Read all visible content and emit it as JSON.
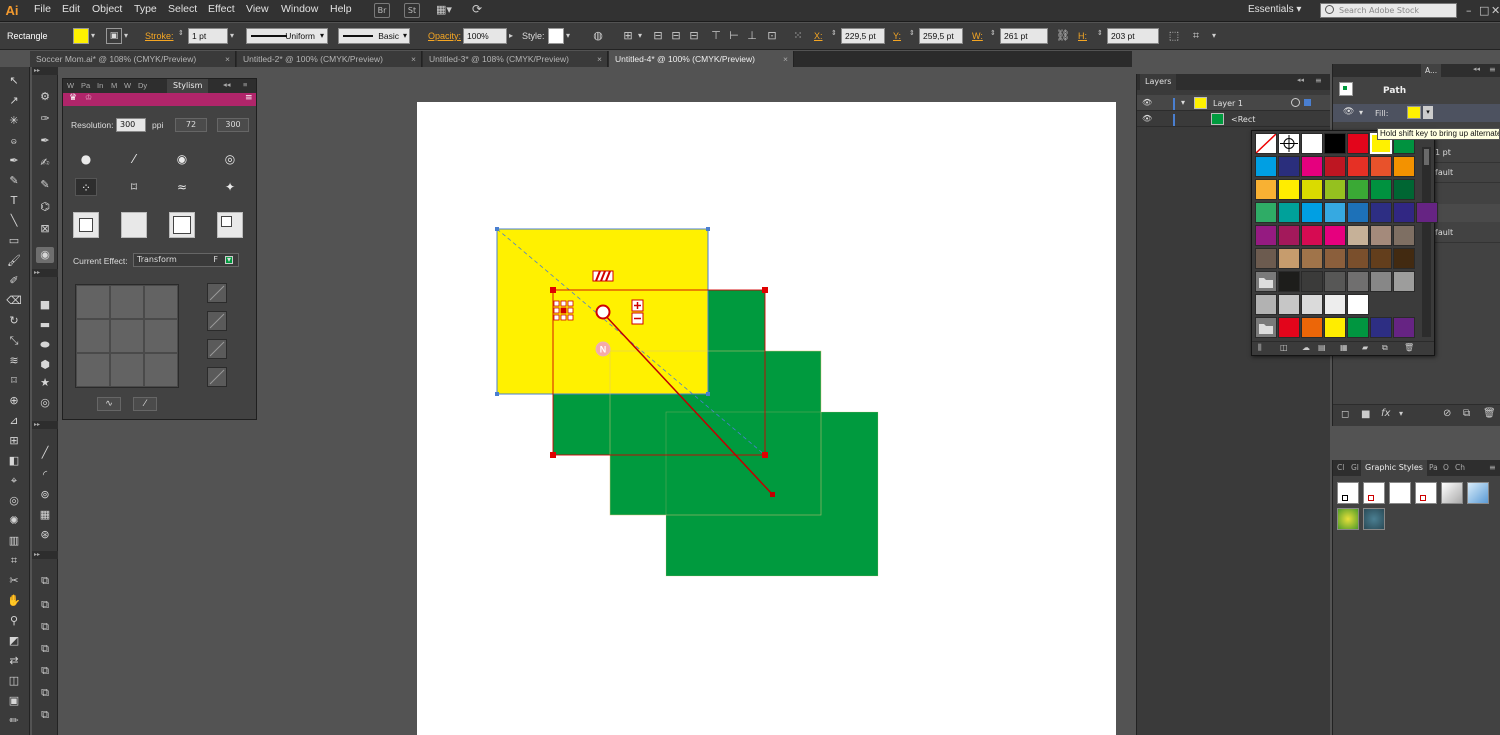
{
  "app": {
    "logo": "Ai",
    "colors": {
      "accent": "#f5a623",
      "yellow": "#fff100",
      "green": "#009a3e",
      "selection": "#e00000",
      "panel": "#424242"
    }
  },
  "menubar": {
    "items": [
      "File",
      "Edit",
      "Object",
      "Type",
      "Select",
      "Effect",
      "View",
      "Window",
      "Help"
    ],
    "bridge": "Br",
    "stock": "St",
    "workspace": "Essentials",
    "search_placeholder": "Search Adobe Stock"
  },
  "control": {
    "object_type": "Rectangle",
    "stroke_label": "Stroke:",
    "stroke_weight": "1 pt",
    "profile": "Uniform",
    "brush": "Basic",
    "opacity_label": "Opacity:",
    "opacity": "100%",
    "style_label": "Style:",
    "x_label": "X:",
    "x": "229,5 pt",
    "y_label": "Y:",
    "y": "259,5 pt",
    "w_label": "W:",
    "w": "261 pt",
    "h_label": "H:",
    "h": "203 pt"
  },
  "tabs": [
    {
      "label": "Soccer Mom.ai* @ 108% (CMYK/Preview)",
      "active": false
    },
    {
      "label": "Untitled-2* @ 100% (CMYK/Preview)",
      "active": false
    },
    {
      "label": "Untitled-3* @ 108% (CMYK/Preview)",
      "active": false
    },
    {
      "label": "Untitled-4* @ 100% (CMYK/Preview)",
      "active": true
    }
  ],
  "stylism": {
    "tabs": [
      "W",
      "Pa",
      "In",
      "M",
      "W",
      "Dy",
      "Stylism"
    ],
    "resolution_label": "Resolution:",
    "resolution": "300",
    "ppi": "ppi",
    "preset_72": "72",
    "preset_300": "300",
    "current_effect_label": "Current Effect:",
    "current_effect": "Transform",
    "effect_flag": "F"
  },
  "layers": {
    "tab": "Layers",
    "layer_name": "Layer 1",
    "sublayer_name": "<Rect"
  },
  "appearance": {
    "tab_short": "A...",
    "title": "Path",
    "fill_label": "Fill:",
    "stroke_value": "1 pt",
    "default_1": "fault",
    "default_2": "fault",
    "tooltip": "Hold shift key to bring up alternate"
  },
  "swatches": {
    "rows": [
      [
        "#ffffff",
        "#000000",
        "#e3051b",
        "#fff100",
        "#00923f"
      ],
      [
        "#009fe3",
        "#2a2e7c",
        "#e5007e",
        "#be1622",
        "#e63025",
        "#e8522b",
        "#f39200"
      ],
      [
        "#f8b133",
        "#ffed00",
        "#dadb00",
        "#95c11f",
        "#3aa935",
        "#00923f",
        "#006633"
      ],
      [
        "#2fac66",
        "#00a19a",
        "#009fe3",
        "#36a9e1",
        "#1d71b8",
        "#2d2e83",
        "#312783",
        "#662483"
      ],
      [
        "#951b81",
        "#a3195b",
        "#d60b52",
        "#e6007e",
        "#c6b198",
        "#a48a7b",
        "#7e6f63"
      ],
      [
        "#6c5b4f",
        "#c69c6d",
        "#a0744a",
        "#8b5f3c",
        "#7a4f2c",
        "#633e1c",
        "#422a11"
      ],
      [
        "#1d1d1b",
        "#3b3b3a",
        "#575756",
        "#706f6f",
        "#878787",
        "#9d9d9c"
      ],
      [
        "#b2b2b2",
        "#c6c6c6",
        "#dadada",
        "#ededed",
        "#ffffff"
      ],
      [
        "#e3051b",
        "#ec6608",
        "#ffed00",
        "#009640",
        "#2d2e83",
        "#662483"
      ]
    ]
  },
  "graphic_styles": {
    "tabs": [
      "Cl",
      "Gl",
      "Graphic Styles",
      "Pa",
      "O",
      "Ch"
    ]
  }
}
